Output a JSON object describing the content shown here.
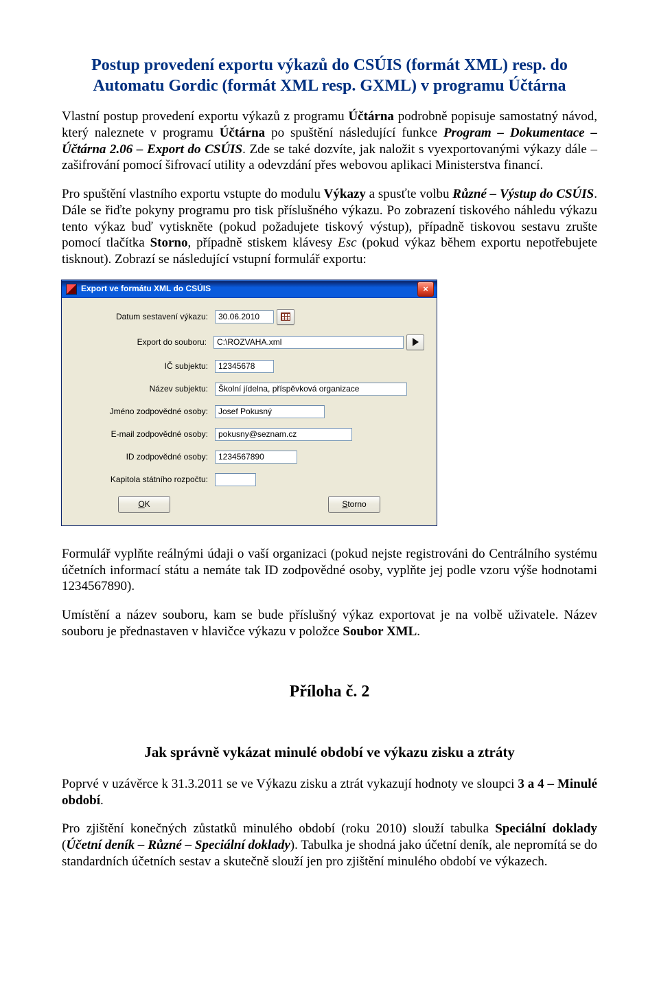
{
  "title": "Postup provedení exportu výkazů do CSÚIS (formát XML) resp. do Automatu Gordic (formát XML resp. GXML) v programu Účtárna",
  "p1": {
    "a": "Vlastní postup provedení exportu výkazů z programu ",
    "b": "Účtárna",
    "c": " podrobně popisuje samostatný návod, který naleznete v programu ",
    "d": "Účtárna",
    "e": " po spuštění následující funkce ",
    "f": "Program – Dokumentace – Účtárna 2.06 – Export do CSÚIS",
    "g": ". Zde se také dozvíte, jak naložit s vyexportovanými výkazy dále – zašifrování pomocí šifrovací utility a odevzdání přes webovou aplikaci Ministerstva financí."
  },
  "p2": {
    "a": "Pro spuštění vlastního exportu vstupte do modulu ",
    "b": "Výkazy",
    "c": " a spusťte volbu ",
    "d": "Různé – Výstup do CSÚIS",
    "e": ". Dále se řiďte pokyny programu pro tisk příslušného výkazu. Po zobrazení tiskového náhledu výkazu tento výkaz buď vytiskněte (pokud požadujete tiskový výstup), případně tiskovou sestavu zrušte pomocí tlačítka ",
    "f": "Storno",
    "g": ", případně stiskem klávesy ",
    "h": "Esc",
    "i": " (pokud výkaz během exportu nepotřebujete tisknout). Zobrazí se následující vstupní formulář exportu:"
  },
  "dlg": {
    "title": "Export ve formátu XML do CSÚIS",
    "close": "×",
    "labels": {
      "datum": "Datum sestavení výkazu:",
      "export": "Export do souboru:",
      "ic": "IČ subjektu:",
      "nazev": "Název subjektu:",
      "jmeno": "Jméno zodpovědné osoby:",
      "email": "E-mail zodpovědné osoby:",
      "id": "ID zodpovědné osoby:",
      "kap": "Kapitola státního rozpočtu:"
    },
    "values": {
      "datum": "30.06.2010",
      "export": "C:\\ROZVAHA.xml",
      "ic": "12345678",
      "nazev": "Školní jídelna, příspěvková organizace",
      "jmeno": "Josef Pokusný",
      "email": "pokusny@seznam.cz",
      "id": "1234567890",
      "kap": ""
    },
    "ok_u": "O",
    "ok_rest": "K",
    "storno_u": "S",
    "storno_rest": "torno"
  },
  "p3": "Formulář vyplňte reálnými údaji o vaší organizaci (pokud nejste registrováni do Centrálního systému účetních informací státu a nemáte tak ID zodpovědné osoby, vyplňte jej podle vzoru výše hodnotami 1234567890).",
  "p4": {
    "a": "Umístění a název souboru, kam se bude příslušný výkaz exportovat je na volbě uživatele. Název souboru je přednastaven v hlavičce výkazu v položce ",
    "b": "Soubor XML",
    "c": "."
  },
  "priloha": "Příloha č. 2",
  "jak": "Jak správně vykázat minulé období ve výkazu zisku a ztráty",
  "p5": {
    "a": "Poprvé v uzávěrce k 31.3.2011 se ve Výkazu zisku a ztrát vykazují hodnoty ve sloupci ",
    "b": "3 a 4 – Minulé období",
    "c": "."
  },
  "p6": {
    "a": "Pro zjištění konečných zůstatků minulého období (roku 2010) slouží tabulka ",
    "b": "Speciální doklady",
    "c": " (",
    "d": "Účetní deník – Různé – Speciální doklady",
    "e": "). Tabulka je shodná jako účetní deník, ale nepromítá se do standardních účetních sestav a skutečně slouží jen pro zjištění minulého období ve výkazech."
  }
}
